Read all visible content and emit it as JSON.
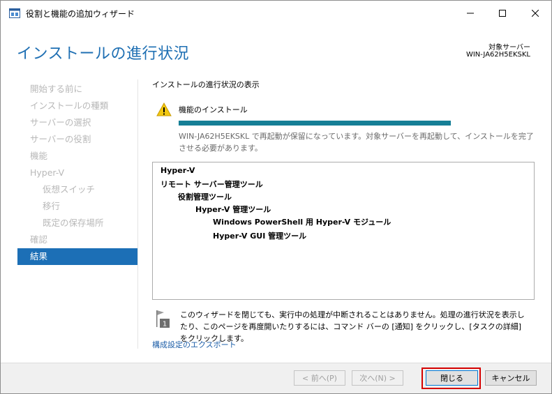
{
  "window": {
    "title": "役割と機能の追加ウィザード",
    "min_symbol": "—",
    "max_symbol": "☐",
    "close_symbol": "✕"
  },
  "header": {
    "page_title": "インストールの進行状況",
    "target_label": "対象サーバー",
    "target_server": "WIN-JA62H5EKSKL"
  },
  "nav": {
    "items": [
      {
        "label": "開始する前に"
      },
      {
        "label": "インストールの種類"
      },
      {
        "label": "サーバーの選択"
      },
      {
        "label": "サーバーの役割"
      },
      {
        "label": "機能"
      },
      {
        "label": "Hyper-V"
      },
      {
        "label": "仮想スイッチ"
      },
      {
        "label": "移行"
      },
      {
        "label": "既定の保存場所"
      },
      {
        "label": "確認"
      },
      {
        "label": "結果"
      }
    ]
  },
  "content": {
    "section_title": "インストールの進行状況の表示",
    "feature_label": "機能のインストール",
    "progress_fraction": 1.0,
    "restart_message": "WIN-JA62H5EKSKL で再起動が保留になっています。対象サーバーを再起動して、インストールを完了させる必要があります。",
    "results": [
      {
        "label": "Hyper-V"
      },
      {
        "label": "リモート サーバー管理ツール"
      },
      {
        "label": "役割管理ツール"
      },
      {
        "label": "Hyper-V 管理ツール"
      },
      {
        "label": "Windows PowerShell 用 Hyper-V モジュール"
      },
      {
        "label": "Hyper-V GUI 管理ツール"
      }
    ],
    "info_icon_number": "1",
    "info_message": "このウィザードを閉じても、実行中の処理が中断されることはありません。処理の進行状況を表示したり、このページを再度開いたりするには、コマンド バーの [通知] をクリックし、[タスクの詳細] をクリックします。",
    "export_link": "構成設定のエクスポート"
  },
  "footer": {
    "prev_label": "< 前へ(P)",
    "next_label": "次へ(N) >",
    "close_label": "閉じる",
    "cancel_label": "キャンセル"
  },
  "colors": {
    "accent": "#1c6fb6",
    "progress": "#167f96",
    "highlight": "#d40000"
  }
}
